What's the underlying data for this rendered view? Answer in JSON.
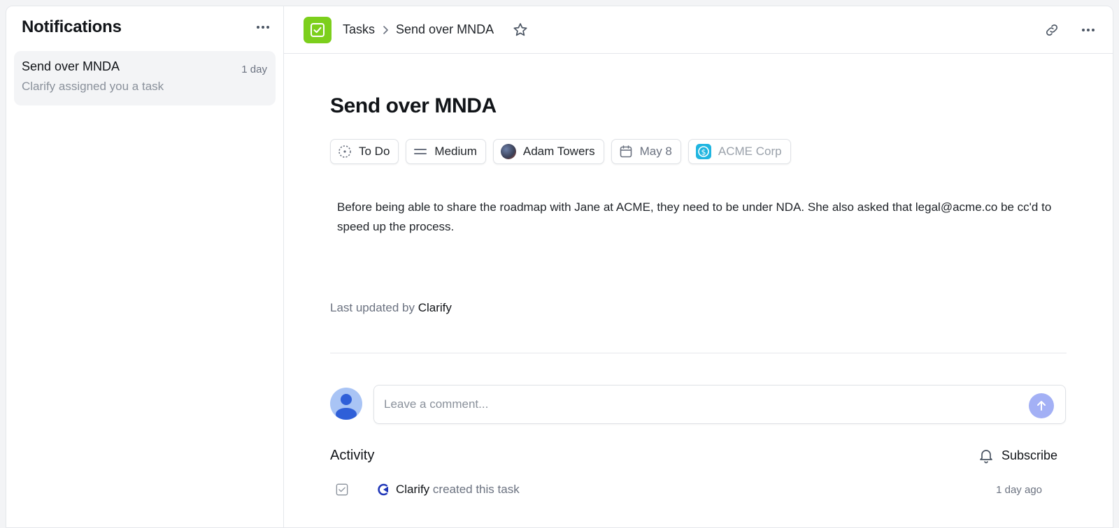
{
  "sidebar": {
    "title": "Notifications",
    "items": [
      {
        "title": "Send over MNDA",
        "subtitle": "Clarify assigned you a task",
        "time": "1 day"
      }
    ]
  },
  "topbar": {
    "breadcrumb": [
      "Tasks",
      "Send over MNDA"
    ],
    "app_icon": "task-check-icon",
    "app_color": "#7ccf1c"
  },
  "task": {
    "title": "Send over MNDA",
    "status": "To Do",
    "priority": "Medium",
    "assignee": "Adam Towers",
    "due_date": "May 8",
    "company": "ACME Corp",
    "description": "Before being able to share the roadmap with Jane at ACME, they need to be under NDA. She also asked that legal@acme.co be cc'd to speed up the process.",
    "updated_prefix": "Last updated by",
    "updated_by": "Clarify"
  },
  "comment": {
    "placeholder": "Leave a comment..."
  },
  "activity": {
    "title": "Activity",
    "subscribe_label": "Subscribe",
    "items": [
      {
        "actor": "Clarify",
        "action": "created this task",
        "time": "1 day ago"
      }
    ]
  }
}
